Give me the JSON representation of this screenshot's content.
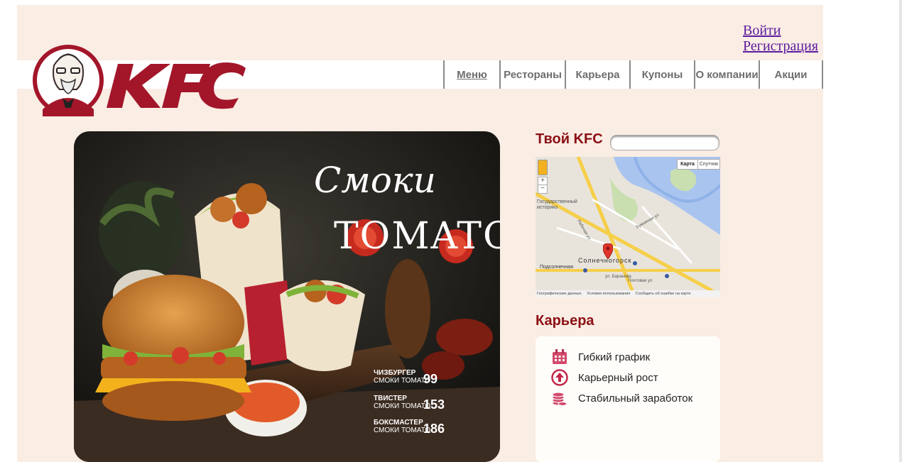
{
  "auth": {
    "login": "Войти",
    "register": "Регистрация"
  },
  "nav": {
    "items": [
      "Меню",
      "Рестораны",
      "Карьера",
      "Купоны",
      "О компании",
      "Акции"
    ]
  },
  "hero": {
    "title_line1": "Смоки",
    "title_line2": "TOMATO",
    "prices": [
      {
        "name1": "ЧИЗБУРГЕР",
        "name2": "СМОКИ ТОМАТО",
        "price": "99"
      },
      {
        "name1": "ТВИСТЕР",
        "name2": "СМОКИ ТОМАТО",
        "price": "153"
      },
      {
        "name1": "БОКСМАСТЕР",
        "name2": "СМОКИ ТОМАТО",
        "price": "186"
      }
    ]
  },
  "sidebar": {
    "your_kfc_title": "Твой KFC",
    "map": {
      "btn_map": "Карта",
      "btn_sat": "Спутник",
      "labels": [
        "Государственный историко",
        "Подсолнечная",
        "Солнечногорск",
        "ул. Баранова",
        "Рабочая ул",
        "Бумажная ул",
        "Почтовая ул"
      ],
      "footer": [
        "Географические данные",
        "Условия использования",
        "Сообщить об ошибке на карте"
      ]
    },
    "career_title": "Карьера",
    "career_items": [
      "Гибкий график",
      "Карьерный рост",
      "Стабильный заработок"
    ]
  },
  "colors": {
    "brand_red": "#a3162a",
    "title_red": "#8b0f14",
    "link_purple": "#5b1a9e",
    "page_bg": "#faede4"
  }
}
